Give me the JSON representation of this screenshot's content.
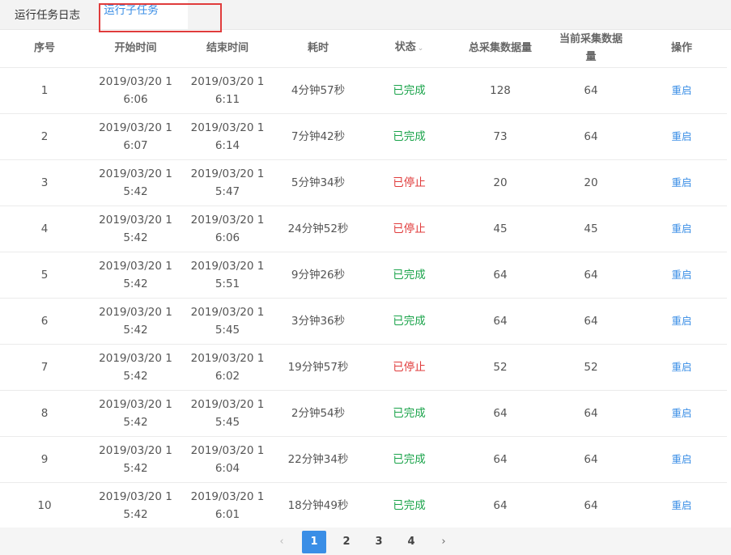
{
  "tabs": [
    {
      "label": "运行任务日志"
    },
    {
      "label": "运行子任务"
    }
  ],
  "table": {
    "headers": {
      "index": "序号",
      "start": "开始时间",
      "end": "结束时间",
      "duration": "耗时",
      "status": "状态",
      "total": "总采集数据量",
      "current_l1": "当前采集数据",
      "current_l2": "量",
      "action": "操作"
    },
    "sort_icon": "chevron-down-icon",
    "rows": [
      {
        "index": "1",
        "start_l1": "2019/03/20 1",
        "start_l2": "6:06",
        "end_l1": "2019/03/20 1",
        "end_l2": "6:11",
        "duration": "4分钟57秒",
        "status": "已完成",
        "total": "128",
        "current": "64",
        "action": "重启"
      },
      {
        "index": "2",
        "start_l1": "2019/03/20 1",
        "start_l2": "6:07",
        "end_l1": "2019/03/20 1",
        "end_l2": "6:14",
        "duration": "7分钟42秒",
        "status": "已完成",
        "total": "73",
        "current": "64",
        "action": "重启"
      },
      {
        "index": "3",
        "start_l1": "2019/03/20 1",
        "start_l2": "5:42",
        "end_l1": "2019/03/20 1",
        "end_l2": "5:47",
        "duration": "5分钟34秒",
        "status": "已停止",
        "total": "20",
        "current": "20",
        "action": "重启"
      },
      {
        "index": "4",
        "start_l1": "2019/03/20 1",
        "start_l2": "5:42",
        "end_l1": "2019/03/20 1",
        "end_l2": "6:06",
        "duration": "24分钟52秒",
        "status": "已停止",
        "total": "45",
        "current": "45",
        "action": "重启"
      },
      {
        "index": "5",
        "start_l1": "2019/03/20 1",
        "start_l2": "5:42",
        "end_l1": "2019/03/20 1",
        "end_l2": "5:51",
        "duration": "9分钟26秒",
        "status": "已完成",
        "total": "64",
        "current": "64",
        "action": "重启"
      },
      {
        "index": "6",
        "start_l1": "2019/03/20 1",
        "start_l2": "5:42",
        "end_l1": "2019/03/20 1",
        "end_l2": "5:45",
        "duration": "3分钟36秒",
        "status": "已完成",
        "total": "64",
        "current": "64",
        "action": "重启"
      },
      {
        "index": "7",
        "start_l1": "2019/03/20 1",
        "start_l2": "5:42",
        "end_l1": "2019/03/20 1",
        "end_l2": "6:02",
        "duration": "19分钟57秒",
        "status": "已停止",
        "total": "52",
        "current": "52",
        "action": "重启"
      },
      {
        "index": "8",
        "start_l1": "2019/03/20 1",
        "start_l2": "5:42",
        "end_l1": "2019/03/20 1",
        "end_l2": "5:45",
        "duration": "2分钟54秒",
        "status": "已完成",
        "total": "64",
        "current": "64",
        "action": "重启"
      },
      {
        "index": "9",
        "start_l1": "2019/03/20 1",
        "start_l2": "5:42",
        "end_l1": "2019/03/20 1",
        "end_l2": "6:04",
        "duration": "22分钟34秒",
        "status": "已完成",
        "total": "64",
        "current": "64",
        "action": "重启"
      },
      {
        "index": "10",
        "start_l1": "2019/03/20 1",
        "start_l2": "5:42",
        "end_l1": "2019/03/20 1",
        "end_l2": "6:01",
        "duration": "18分钟49秒",
        "status": "已完成",
        "total": "64",
        "current": "64",
        "action": "重启"
      }
    ]
  },
  "colors": {
    "status_done": "#1aa34a",
    "status_stopped": "#e03c3c",
    "accent": "#3a8ee6",
    "highlight_box": "#e03c3c"
  },
  "pagination": {
    "prev_icon": "chevron-left-icon",
    "next_icon": "chevron-right-icon",
    "pages": [
      "1",
      "2",
      "3",
      "4"
    ],
    "current_page": "1"
  }
}
